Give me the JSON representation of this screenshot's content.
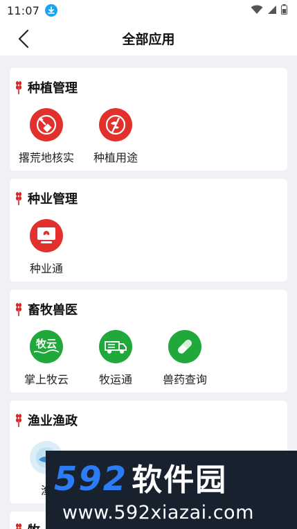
{
  "status_bar": {
    "time": "11:07"
  },
  "header": {
    "title": "全部应用"
  },
  "sections": [
    {
      "title": "种植管理",
      "apps": [
        {
          "label": "撂荒地核实",
          "icon": "farmland-satellite-icon"
        },
        {
          "label": "种植用途",
          "icon": "crop-usage-icon"
        }
      ]
    },
    {
      "title": "种业管理",
      "apps": [
        {
          "label": "种业通",
          "icon": "seed-monitor-icon"
        }
      ]
    },
    {
      "title": "畜牧兽医",
      "apps": [
        {
          "label": "掌上牧云",
          "icon": "muyun-logo-icon",
          "icon_text": "牧云"
        },
        {
          "label": "牧运通",
          "icon": "livestock-truck-icon"
        },
        {
          "label": "兽药查询",
          "icon": "pill-icon"
        }
      ]
    },
    {
      "title": "渔业渔政",
      "apps": [
        {
          "label": "渔",
          "icon": "fishery-icon"
        }
      ]
    },
    {
      "title": "牧"
    }
  ],
  "watermark": {
    "brand_num": "592",
    "brand_cn": "软件园",
    "url": "www.592xiazai.com"
  },
  "colors": {
    "red_icon": "#e2312d",
    "green_icon": "#20a93a",
    "background": "#f0f1f5",
    "accent_wheat": "#d42424"
  }
}
